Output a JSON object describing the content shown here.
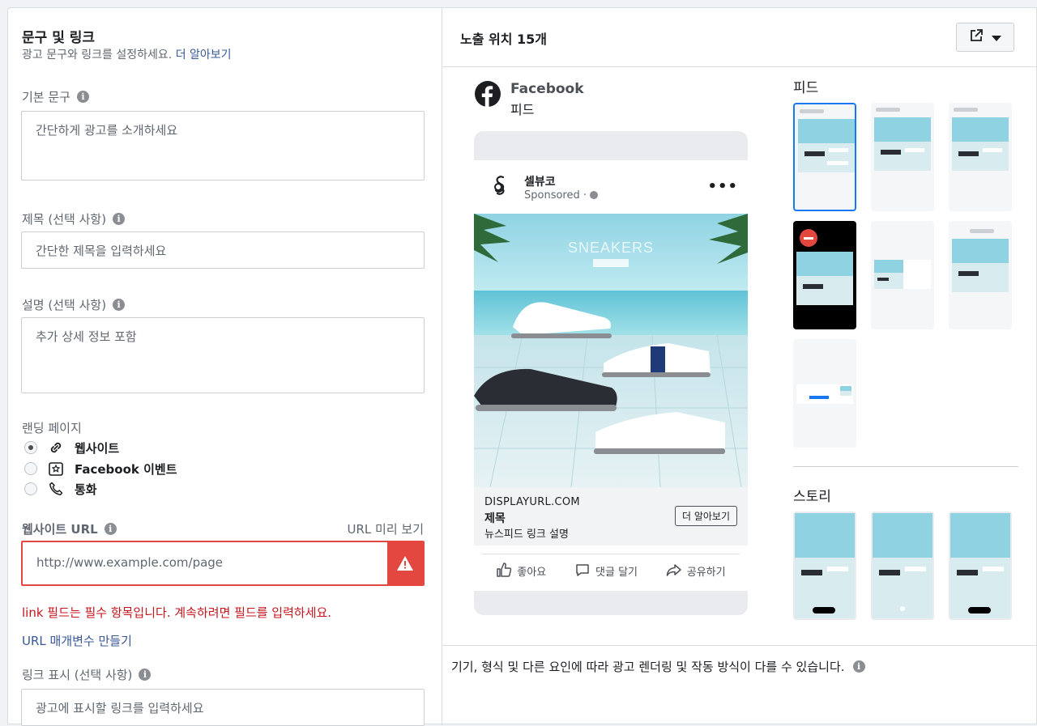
{
  "left": {
    "section_title": "문구 및 링크",
    "section_subtitle": "광고 문구와 링크를 설정하세요.",
    "learn_more": "더 알아보기",
    "primary_text": {
      "label": "기본 문구",
      "placeholder": "간단하게 광고를 소개하세요"
    },
    "headline": {
      "label": "제목 (선택 사항)",
      "placeholder": "간단한 제목을 입력하세요"
    },
    "description": {
      "label": "설명 (선택 사항)",
      "placeholder": "추가 상세 정보 포함"
    },
    "landing": {
      "label": "랜딩 페이지",
      "options": [
        {
          "label": "웹사이트",
          "icon": "link-icon",
          "selected": true
        },
        {
          "label": "Facebook 이벤트",
          "icon": "event-star-icon",
          "selected": false
        },
        {
          "label": "통화",
          "icon": "phone-icon",
          "selected": false
        }
      ]
    },
    "website_url": {
      "label": "웹사이트 URL",
      "preview": "URL 미리 보기",
      "placeholder": "http://www.example.com/page"
    },
    "error_message": "link 필드는 필수 항목입니다. 계속하려면 필드를 입력하세요.",
    "url_params": "URL 매개변수 만들기",
    "display_link": {
      "label": "링크 표시 (선택 사항)",
      "placeholder": "광고에 표시할 링크를 입력하세요"
    }
  },
  "right": {
    "title": "노출 위치 15개",
    "platform": "Facebook",
    "placement": "피드",
    "post": {
      "page_name": "셀뷰코",
      "sponsored": "Sponsored · ",
      "image_text": "SNEAKERS",
      "display_url": "DISPLAYURL.COM",
      "headline": "제목",
      "description": "뉴스피드 링크 설명",
      "cta": "더 알아보기"
    },
    "actions": {
      "like": "좋아요",
      "comment": "댓글 달기",
      "share": "공유하기"
    },
    "feed_heading": "피드",
    "stories_heading": "스토리",
    "note": "기기, 형식 및 다른 요인에 따라 광고 렌더링 및 작동 방식이 다를 수 있습니다."
  },
  "colors": {
    "error": "#e4473f",
    "link": "#385898",
    "selected": "#1877f2"
  }
}
